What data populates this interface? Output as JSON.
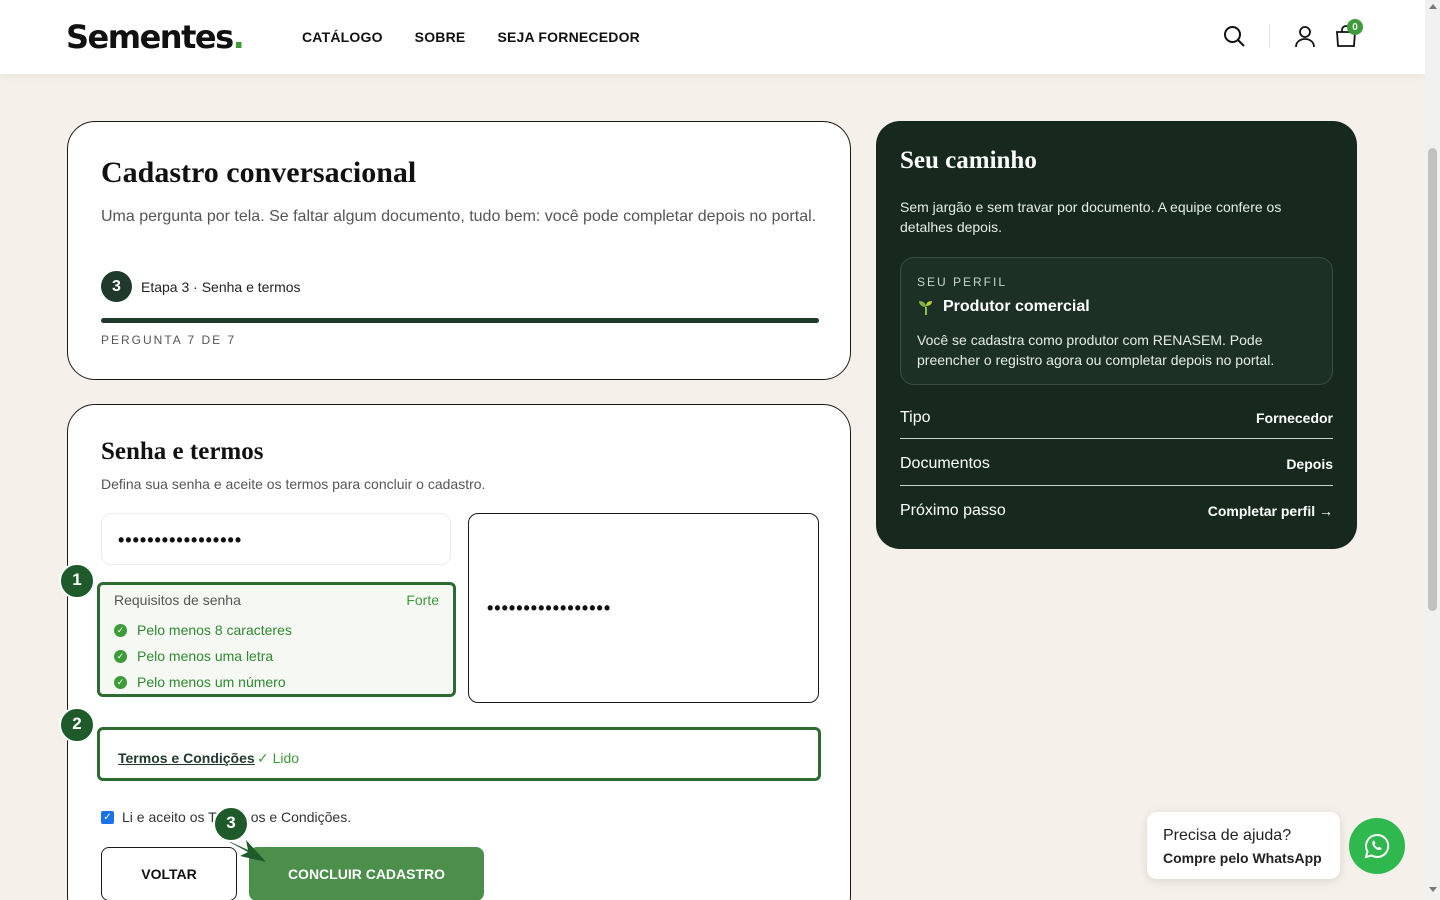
{
  "header": {
    "logo": "Sementes",
    "nav": [
      "CATÁLOGO",
      "SOBRE",
      "SEJA FORNECEDOR"
    ],
    "cart_count": "0",
    "icons": [
      "search-icon",
      "user-icon",
      "cart-icon"
    ]
  },
  "intro": {
    "title": "Cadastro conversacional",
    "description": "Uma pergunta por tela. Se faltar algum documento, tudo bem: você pode completar depois no portal.",
    "step_number": "3",
    "step_label": "Etapa 3 · Senha e termos",
    "progress": 1.0,
    "question_label": "PERGUNTA 7 DE 7"
  },
  "form": {
    "title": "Senha e termos",
    "description": "Defina sua senha e aceite os termos para concluir o cadastro.",
    "password_value": "•••••••••••••••••",
    "confirm_value": "•••••••••••••••••",
    "requirements_title": "Requisitos de senha",
    "strength": "Forte",
    "requirements": [
      "Pelo menos 8 caracteres",
      "Pelo menos uma letra",
      "Pelo menos um número"
    ],
    "terms_link": "Termos e Condições",
    "terms_status": "✓ Lido",
    "accept_label_a": "Li e aceito os T",
    "accept_label_b": "os e Condições.",
    "back_label": "VOLTAR",
    "finish_label": "CONCLUIR CADASTRO"
  },
  "markers": [
    "1",
    "2",
    "3"
  ],
  "panel": {
    "title": "Seu caminho",
    "description": "Sem jargão e sem travar por documento. A equipe confere os detalhes depois.",
    "profile_label": "SEU PERFIL",
    "profile_name": "Produtor comercial",
    "profile_desc": "Você se cadastra como produtor com RENASEM. Pode preencher o registro agora ou completar depois no portal.",
    "rows": [
      {
        "key": "Tipo",
        "value": "Fornecedor"
      },
      {
        "key": "Documentos",
        "value": "Depois"
      },
      {
        "key": "Próximo passo",
        "value": "Completar perfil →"
      }
    ]
  },
  "help": {
    "question": "Precisa de ajuda?",
    "sub": "Compre pelo WhatsApp"
  },
  "colors": {
    "dark_green": "#17291f",
    "accent_green": "#3d9b3a",
    "button_green": "#4b8f4a",
    "whatsapp": "#2fb84e"
  }
}
